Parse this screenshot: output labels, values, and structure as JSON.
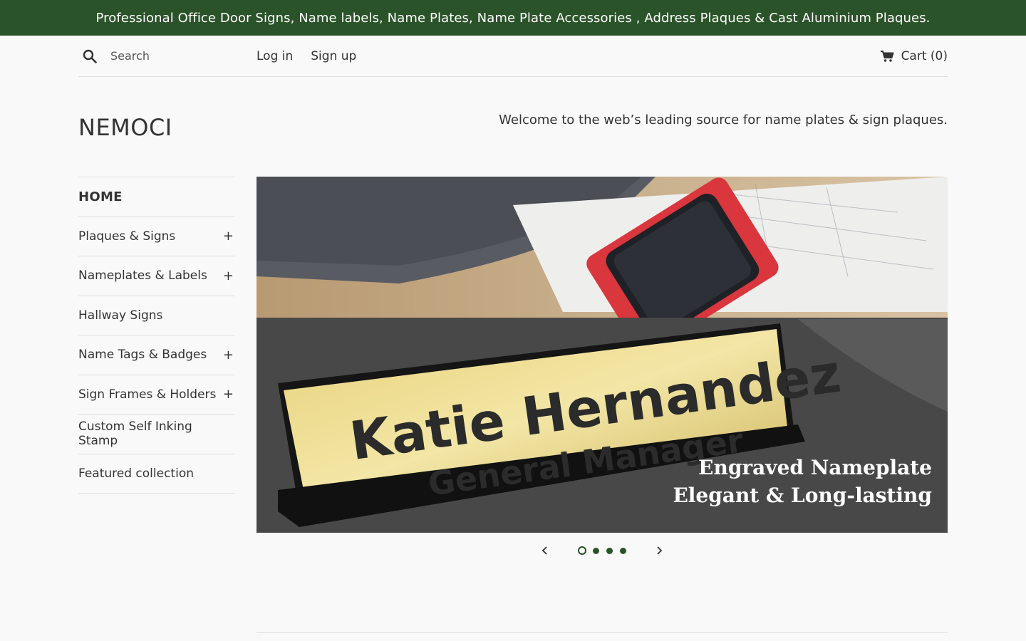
{
  "announcement": "Professional Office Door Signs, Name labels, Name Plates, Name Plate Accessories , Address Plaques & Cast Aluminium Plaques.",
  "header": {
    "search_placeholder": "Search",
    "login_label": "Log in",
    "signup_label": "Sign up",
    "cart_label": "Cart (0)"
  },
  "logo": "NEMOCI",
  "welcome": "Welcome to the web’s leading source for name plates & sign plaques.",
  "sidebar": {
    "items": [
      {
        "label": "HOME",
        "expandable": false
      },
      {
        "label": "Plaques & Signs",
        "expandable": true
      },
      {
        "label": "Nameplates & Labels",
        "expandable": true
      },
      {
        "label": "Hallway Signs",
        "expandable": false
      },
      {
        "label": "Name Tags & Badges",
        "expandable": true
      },
      {
        "label": "Sign Frames & Holders",
        "expandable": true
      },
      {
        "label": "Custom Self Inking Stamp",
        "expandable": false
      },
      {
        "label": "Featured collection",
        "expandable": false
      }
    ],
    "expand_glyph": "+"
  },
  "slide": {
    "plate_line1": "Katie Hernandez",
    "plate_line2": "General Manager",
    "caption_line1": "Engraved Nameplate",
    "caption_line2": "Elegant & Long-lasting",
    "active_slide": 1,
    "slide_count": 4
  },
  "colors": {
    "brand_green": "#2b5329",
    "background": "#f9f9f9",
    "text": "#333333"
  },
  "icons": [
    "search-icon",
    "cart-icon",
    "chevron-left-icon",
    "chevron-right-icon"
  ]
}
